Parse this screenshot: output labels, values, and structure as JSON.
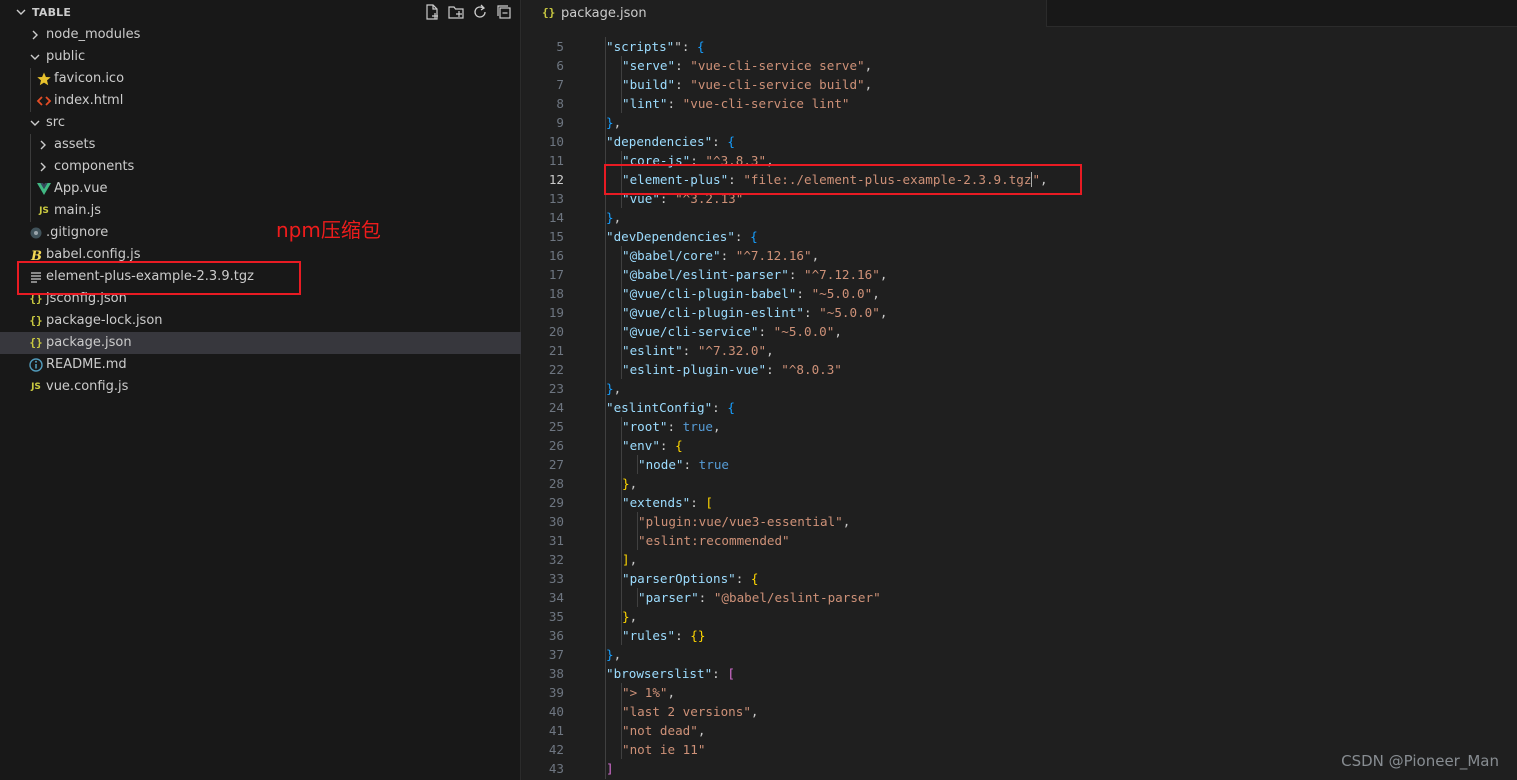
{
  "explorer": {
    "title": "TABLE",
    "actions": [
      "new-file-icon",
      "new-folder-icon",
      "refresh-icon",
      "collapse-all-icon"
    ],
    "items": [
      {
        "label": "node_modules",
        "kind": "folder",
        "open": false,
        "depth": 0
      },
      {
        "label": "public",
        "kind": "folder",
        "open": true,
        "depth": 0
      },
      {
        "label": "favicon.ico",
        "kind": "file",
        "icon": "star",
        "depth": 1
      },
      {
        "label": "index.html",
        "kind": "file",
        "icon": "html",
        "depth": 1
      },
      {
        "label": "src",
        "kind": "folder",
        "open": true,
        "depth": 0
      },
      {
        "label": "assets",
        "kind": "folder",
        "open": false,
        "depth": 1
      },
      {
        "label": "components",
        "kind": "folder",
        "open": false,
        "depth": 1
      },
      {
        "label": "App.vue",
        "kind": "file",
        "icon": "vue",
        "depth": 1
      },
      {
        "label": "main.js",
        "kind": "file",
        "icon": "js",
        "depth": 1
      },
      {
        "label": ".gitignore",
        "kind": "file",
        "icon": "git",
        "depth": 0
      },
      {
        "label": "babel.config.js",
        "kind": "file",
        "icon": "babel",
        "depth": 0
      },
      {
        "label": "element-plus-example-2.3.9.tgz",
        "kind": "file",
        "icon": "lines",
        "depth": 0
      },
      {
        "label": "jsconfig.json",
        "kind": "file",
        "icon": "json",
        "depth": 0
      },
      {
        "label": "package-lock.json",
        "kind": "file",
        "icon": "json",
        "depth": 0
      },
      {
        "label": "package.json",
        "kind": "file",
        "icon": "json",
        "depth": 0,
        "selected": true
      },
      {
        "label": "README.md",
        "kind": "file",
        "icon": "info",
        "depth": 0
      },
      {
        "label": "vue.config.js",
        "kind": "file",
        "icon": "js",
        "depth": 0
      }
    ]
  },
  "annotation": {
    "label": "npm压缩包",
    "color": "#e81b23"
  },
  "editor": {
    "tab": {
      "icon_text": "{}",
      "label": "package.json"
    },
    "current_line": 12,
    "lines": [
      {
        "n": 5,
        "i": 1,
        "t": [
          [
            "k",
            "\"scripts\""
          ],
          [
            "",
            "\": "
          ],
          [
            "p2",
            "{"
          ]
        ]
      },
      {
        "n": 6,
        "i": 2,
        "t": [
          [
            "k",
            "\"serve\""
          ],
          [
            "",
            ": "
          ],
          [
            "s",
            "\"vue-cli-service serve\""
          ],
          [
            "",
            ","
          ]
        ]
      },
      {
        "n": 7,
        "i": 2,
        "t": [
          [
            "k",
            "\"build\""
          ],
          [
            "",
            ": "
          ],
          [
            "s",
            "\"vue-cli-service build\""
          ],
          [
            "",
            ","
          ]
        ]
      },
      {
        "n": 8,
        "i": 2,
        "t": [
          [
            "k",
            "\"lint\""
          ],
          [
            "",
            ": "
          ],
          [
            "s",
            "\"vue-cli-service lint\""
          ]
        ]
      },
      {
        "n": 9,
        "i": 1,
        "t": [
          [
            "p2",
            "}"
          ],
          [
            "",
            ","
          ]
        ]
      },
      {
        "n": 10,
        "i": 1,
        "t": [
          [
            "k",
            "\"dependencies\""
          ],
          [
            "",
            ": "
          ],
          [
            "p2",
            "{"
          ]
        ]
      },
      {
        "n": 11,
        "i": 2,
        "t": [
          [
            "k",
            "\"core-js\""
          ],
          [
            "",
            ": "
          ],
          [
            "s",
            "\"^3.8.3\""
          ],
          [
            "",
            ","
          ]
        ]
      },
      {
        "n": 12,
        "i": 2,
        "t": [
          [
            "k",
            "\"element-plus\""
          ],
          [
            "",
            ": "
          ],
          [
            "s",
            "\"file:./element-plus-example-2.3.9.tgz"
          ],
          [
            "cursor",
            ""
          ],
          [
            "s",
            "\""
          ],
          [
            "",
            ","
          ]
        ]
      },
      {
        "n": 13,
        "i": 2,
        "t": [
          [
            "k",
            "\"vue\""
          ],
          [
            "",
            ": "
          ],
          [
            "s",
            "\"^3.2.13\""
          ]
        ]
      },
      {
        "n": 14,
        "i": 1,
        "t": [
          [
            "p2",
            "}"
          ],
          [
            "",
            ","
          ]
        ]
      },
      {
        "n": 15,
        "i": 1,
        "t": [
          [
            "k",
            "\"devDependencies\""
          ],
          [
            "",
            ": "
          ],
          [
            "p2",
            "{"
          ]
        ]
      },
      {
        "n": 16,
        "i": 2,
        "t": [
          [
            "k",
            "\"@babel/core\""
          ],
          [
            "",
            ": "
          ],
          [
            "s",
            "\"^7.12.16\""
          ],
          [
            "",
            ","
          ]
        ]
      },
      {
        "n": 17,
        "i": 2,
        "t": [
          [
            "k",
            "\"@babel/eslint-parser\""
          ],
          [
            "",
            ": "
          ],
          [
            "s",
            "\"^7.12.16\""
          ],
          [
            "",
            ","
          ]
        ]
      },
      {
        "n": 18,
        "i": 2,
        "t": [
          [
            "k",
            "\"@vue/cli-plugin-babel\""
          ],
          [
            "",
            ": "
          ],
          [
            "s",
            "\"~5.0.0\""
          ],
          [
            "",
            ","
          ]
        ]
      },
      {
        "n": 19,
        "i": 2,
        "t": [
          [
            "k",
            "\"@vue/cli-plugin-eslint\""
          ],
          [
            "",
            ": "
          ],
          [
            "s",
            "\"~5.0.0\""
          ],
          [
            "",
            ","
          ]
        ]
      },
      {
        "n": 20,
        "i": 2,
        "t": [
          [
            "k",
            "\"@vue/cli-service\""
          ],
          [
            "",
            ": "
          ],
          [
            "s",
            "\"~5.0.0\""
          ],
          [
            "",
            ","
          ]
        ]
      },
      {
        "n": 21,
        "i": 2,
        "t": [
          [
            "k",
            "\"eslint\""
          ],
          [
            "",
            ": "
          ],
          [
            "s",
            "\"^7.32.0\""
          ],
          [
            "",
            ","
          ]
        ]
      },
      {
        "n": 22,
        "i": 2,
        "t": [
          [
            "k",
            "\"eslint-plugin-vue\""
          ],
          [
            "",
            ": "
          ],
          [
            "s",
            "\"^8.0.3\""
          ]
        ]
      },
      {
        "n": 23,
        "i": 1,
        "t": [
          [
            "p2",
            "}"
          ],
          [
            "",
            ","
          ]
        ]
      },
      {
        "n": 24,
        "i": 1,
        "t": [
          [
            "k",
            "\"eslintConfig\""
          ],
          [
            "",
            ": "
          ],
          [
            "p2",
            "{"
          ]
        ]
      },
      {
        "n": 25,
        "i": 2,
        "t": [
          [
            "k",
            "\"root\""
          ],
          [
            "",
            ": "
          ],
          [
            "b",
            "true"
          ],
          [
            "",
            ","
          ]
        ]
      },
      {
        "n": 26,
        "i": 2,
        "t": [
          [
            "k",
            "\"env\""
          ],
          [
            "",
            ": "
          ],
          [
            "p3",
            "{"
          ]
        ]
      },
      {
        "n": 27,
        "i": 3,
        "t": [
          [
            "k",
            "\"node\""
          ],
          [
            "",
            ": "
          ],
          [
            "b",
            "true"
          ]
        ]
      },
      {
        "n": 28,
        "i": 2,
        "t": [
          [
            "p3",
            "}"
          ],
          [
            "",
            ","
          ]
        ]
      },
      {
        "n": 29,
        "i": 2,
        "t": [
          [
            "k",
            "\"extends\""
          ],
          [
            "",
            ": "
          ],
          [
            "p3",
            "["
          ]
        ]
      },
      {
        "n": 30,
        "i": 3,
        "t": [
          [
            "s",
            "\"plugin:vue/vue3-essential\""
          ],
          [
            "",
            ","
          ]
        ]
      },
      {
        "n": 31,
        "i": 3,
        "t": [
          [
            "s",
            "\"eslint:recommended\""
          ]
        ]
      },
      {
        "n": 32,
        "i": 2,
        "t": [
          [
            "p3",
            "]"
          ],
          [
            "",
            ","
          ]
        ]
      },
      {
        "n": 33,
        "i": 2,
        "t": [
          [
            "k",
            "\"parserOptions\""
          ],
          [
            "",
            ": "
          ],
          [
            "p3",
            "{"
          ]
        ]
      },
      {
        "n": 34,
        "i": 3,
        "t": [
          [
            "k",
            "\"parser\""
          ],
          [
            "",
            ": "
          ],
          [
            "s",
            "\"@babel/eslint-parser\""
          ]
        ]
      },
      {
        "n": 35,
        "i": 2,
        "t": [
          [
            "p3",
            "}"
          ],
          [
            "",
            ","
          ]
        ]
      },
      {
        "n": 36,
        "i": 2,
        "t": [
          [
            "k",
            "\"rules\""
          ],
          [
            "",
            ": "
          ],
          [
            "p3",
            "{}"
          ]
        ]
      },
      {
        "n": 37,
        "i": 1,
        "t": [
          [
            "p2",
            "}"
          ],
          [
            "",
            ","
          ]
        ]
      },
      {
        "n": 38,
        "i": 1,
        "t": [
          [
            "k",
            "\"browserslist\""
          ],
          [
            "",
            ": "
          ],
          [
            "p1",
            "["
          ]
        ]
      },
      {
        "n": 39,
        "i": 2,
        "t": [
          [
            "s",
            "\"> 1%\""
          ],
          [
            "",
            ","
          ]
        ]
      },
      {
        "n": 40,
        "i": 2,
        "t": [
          [
            "s",
            "\"last 2 versions\""
          ],
          [
            "",
            ","
          ]
        ]
      },
      {
        "n": 41,
        "i": 2,
        "t": [
          [
            "s",
            "\"not dead\""
          ],
          [
            "",
            ","
          ]
        ]
      },
      {
        "n": 42,
        "i": 2,
        "t": [
          [
            "s",
            "\"not ie 11\""
          ]
        ]
      },
      {
        "n": 43,
        "i": 1,
        "t": [
          [
            "p1",
            "]"
          ]
        ]
      }
    ]
  },
  "watermark": "CSDN @Pioneer_Man",
  "colors": {
    "sidebar_bg": "#181818",
    "editor_bg": "#1f1f1f",
    "selection_bg": "#37373d",
    "json_key": "#9cdcfe",
    "json_string": "#ce9178",
    "json_boolean": "#569cd6"
  }
}
